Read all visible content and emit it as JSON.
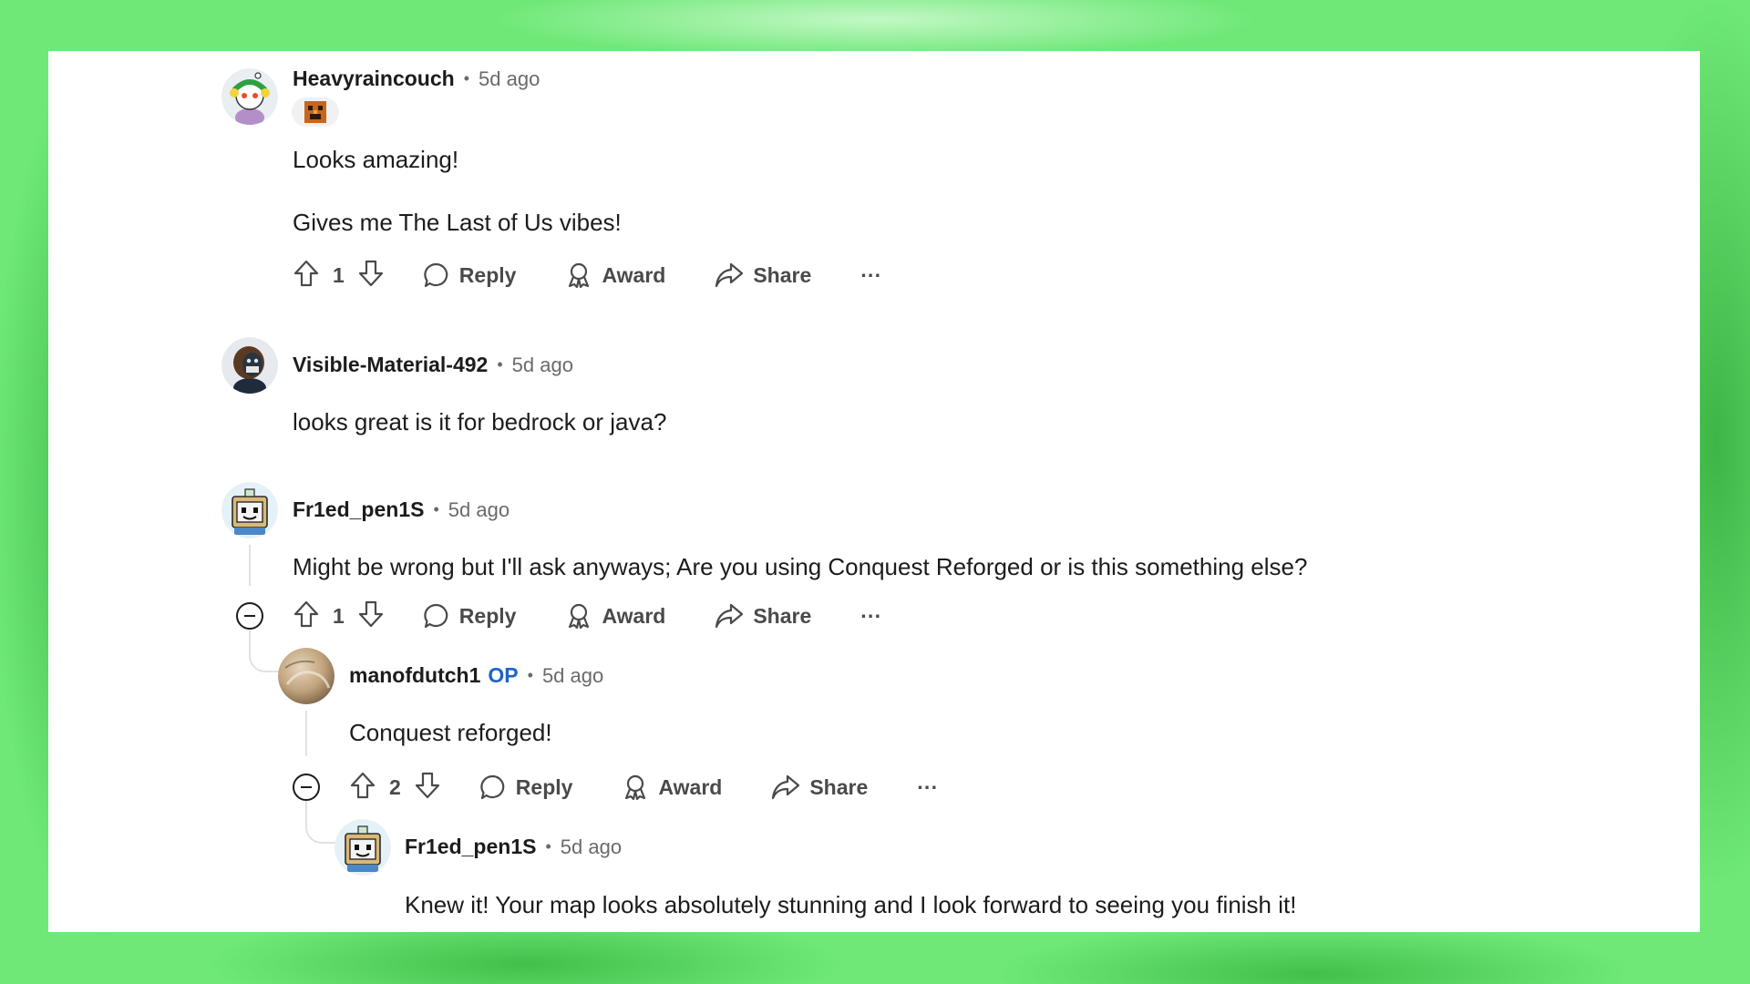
{
  "colors": {
    "background": "#6fe878",
    "op_badge": "#2062c8",
    "meta": "#6a6a6a"
  },
  "comments": [
    {
      "username": "Heavyraincouch",
      "time": "5d ago",
      "body": [
        "Looks amazing!",
        "Gives me The Last of Us vibes!"
      ],
      "votes": "1",
      "has_flair": true
    },
    {
      "username": "Visible-Material-492",
      "time": "5d ago",
      "body": [
        "looks great is it for bedrock or java?"
      ]
    },
    {
      "username": "Fr1ed_pen1S",
      "time": "5d ago",
      "body": [
        "Might be wrong but I'll ask anyways; Are you using Conquest Reforged or is this something else?"
      ],
      "votes": "1"
    },
    {
      "username": "manofdutch1",
      "op_label": "OP",
      "time": "5d ago",
      "body": [
        "Conquest reforged!"
      ],
      "votes": "2"
    },
    {
      "username": "Fr1ed_pen1S",
      "time": "5d ago",
      "body": [
        "Knew it! Your map looks absolutely stunning and I look forward to seeing you finish it!"
      ]
    }
  ],
  "actions": {
    "reply": "Reply",
    "award": "Award",
    "share": "Share",
    "more": "···"
  },
  "separator": "•"
}
